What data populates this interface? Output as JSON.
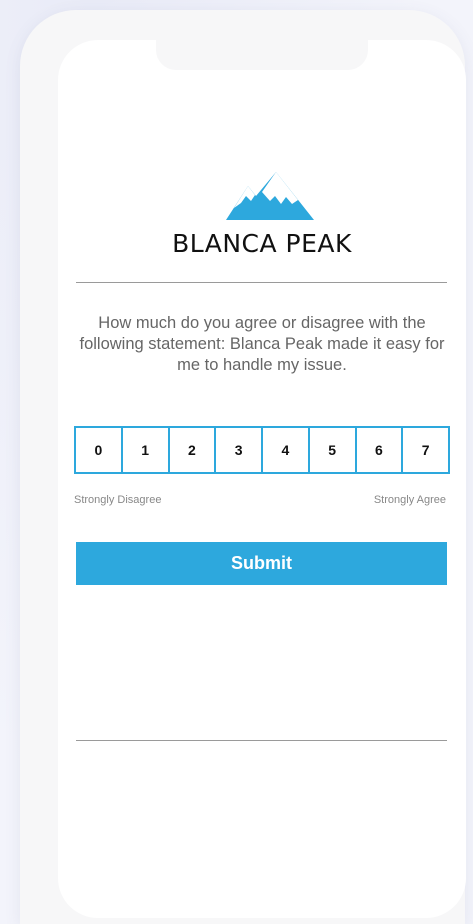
{
  "brand": {
    "name": "BLANCA PEAK",
    "logo_icon": "mountain-icon",
    "accent_color": "#2da8dd"
  },
  "survey": {
    "question": "How much do you agree or disagree with the following statement: Blanca Peak made it easy for me to handle my issue.",
    "scale": [
      "0",
      "1",
      "2",
      "3",
      "4",
      "5",
      "6",
      "7"
    ],
    "low_label": "Strongly Disagree",
    "high_label": "Strongly Agree",
    "submit_label": "Submit"
  }
}
